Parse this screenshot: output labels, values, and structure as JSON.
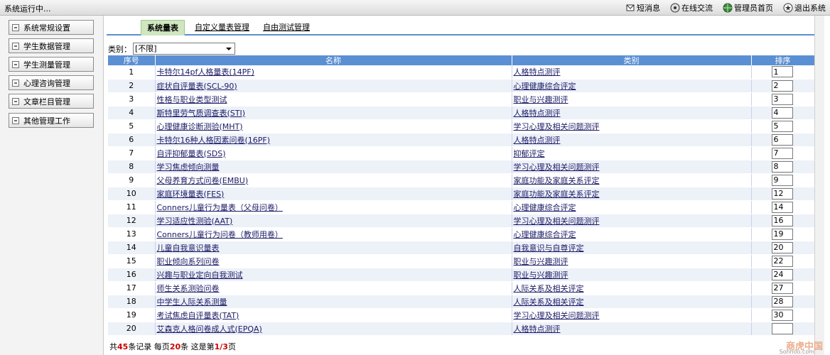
{
  "topbar": {
    "status": "系统运行中...",
    "nav": [
      {
        "label": "短消息",
        "icon": "message-icon"
      },
      {
        "label": "在线交流",
        "icon": "chat-icon"
      },
      {
        "label": "管理员首页",
        "icon": "globe-icon"
      },
      {
        "label": "退出系统",
        "icon": "exit-icon"
      }
    ]
  },
  "sidebar": {
    "items": [
      {
        "label": "系统常规设置"
      },
      {
        "label": "学生数据管理"
      },
      {
        "label": "学生测量管理"
      },
      {
        "label": "心理咨询管理"
      },
      {
        "label": "文章栏目管理"
      },
      {
        "label": "其他管理工作"
      }
    ]
  },
  "tabs": [
    {
      "label": "系统量表",
      "active": true
    },
    {
      "label": "自定义量表管理",
      "active": false
    },
    {
      "label": "自由测试管理",
      "active": false
    }
  ],
  "filter": {
    "label": "类别：",
    "selected": "[不限]"
  },
  "table": {
    "headers": [
      "序号",
      "名称",
      "类别",
      "排序"
    ],
    "rows": [
      {
        "seq": "1",
        "name": "卡特尔14pf人格量表(14PF)",
        "category": "人格特点测评",
        "order": "1"
      },
      {
        "seq": "2",
        "name": "症状自评量表(SCL-90)",
        "category": "心理健康综合评定",
        "order": "2"
      },
      {
        "seq": "3",
        "name": "性格与职业类型测试",
        "category": "职业与兴趣测评",
        "order": "3"
      },
      {
        "seq": "4",
        "name": "斯特里劳气质调查表(STI)",
        "category": "人格特点测评",
        "order": "4"
      },
      {
        "seq": "5",
        "name": "心理健康诊断测验(MHT)",
        "category": "学习心理及相关问题测评",
        "order": "5"
      },
      {
        "seq": "6",
        "name": "卡特尔16种人格因素问卷(16PF)",
        "category": "人格特点测评",
        "order": "6"
      },
      {
        "seq": "7",
        "name": "自评抑郁量表(SDS)",
        "category": "抑郁评定",
        "order": "7"
      },
      {
        "seq": "8",
        "name": "学习焦虑倾向测量",
        "category": "学习心理及相关问题测评",
        "order": "8"
      },
      {
        "seq": "9",
        "name": "父母养育方式问卷(EMBU)",
        "category": "家庭功能及家庭关系评定",
        "order": "9"
      },
      {
        "seq": "10",
        "name": "家庭环境量表(FES)",
        "category": "家庭功能及家庭关系评定",
        "order": "12"
      },
      {
        "seq": "11",
        "name": "Conners儿童行为量表（父母问卷）",
        "category": "心理健康综合评定",
        "order": "14"
      },
      {
        "seq": "12",
        "name": "学习适应性测验(AAT)",
        "category": "学习心理及相关问题测评",
        "order": "16"
      },
      {
        "seq": "13",
        "name": "Conners儿童行为问卷（教师用卷）",
        "category": "心理健康综合评定",
        "order": "19"
      },
      {
        "seq": "14",
        "name": "儿童自我意识量表",
        "category": "自我意识与自尊评定",
        "order": "20"
      },
      {
        "seq": "15",
        "name": "职业倾向系列问卷",
        "category": "职业与兴趣测评",
        "order": "22"
      },
      {
        "seq": "16",
        "name": "兴趣与职业定向自我测试",
        "category": "职业与兴趣测评",
        "order": "24"
      },
      {
        "seq": "17",
        "name": "师生关系测验问卷",
        "category": "人际关系及相关评定",
        "order": "27"
      },
      {
        "seq": "18",
        "name": "中学生人际关系测量",
        "category": "人际关系及相关评定",
        "order": "28"
      },
      {
        "seq": "19",
        "name": "考试焦虑自评量表(TAT)",
        "category": "学习心理及相关问题测评",
        "order": "30"
      },
      {
        "seq": "20",
        "name": "艾森克人格问卷成人式(EPQA)",
        "category": "人格特点测评",
        "order": ""
      }
    ]
  },
  "footer": {
    "prefix": "共",
    "total": "45",
    "mid1": "条记录 每页",
    "per_page": "20",
    "mid2": "条 这是第",
    "current": "1/3",
    "suffix": "页"
  },
  "watermark": {
    "text": "商虎中国",
    "sub": "Sonhoo.com"
  },
  "colors": {
    "header_blue": "#5b8fd3",
    "row_alt": "#edf1f8",
    "active_tab": "#cfe6c1",
    "footer_red": "#cc0000"
  }
}
